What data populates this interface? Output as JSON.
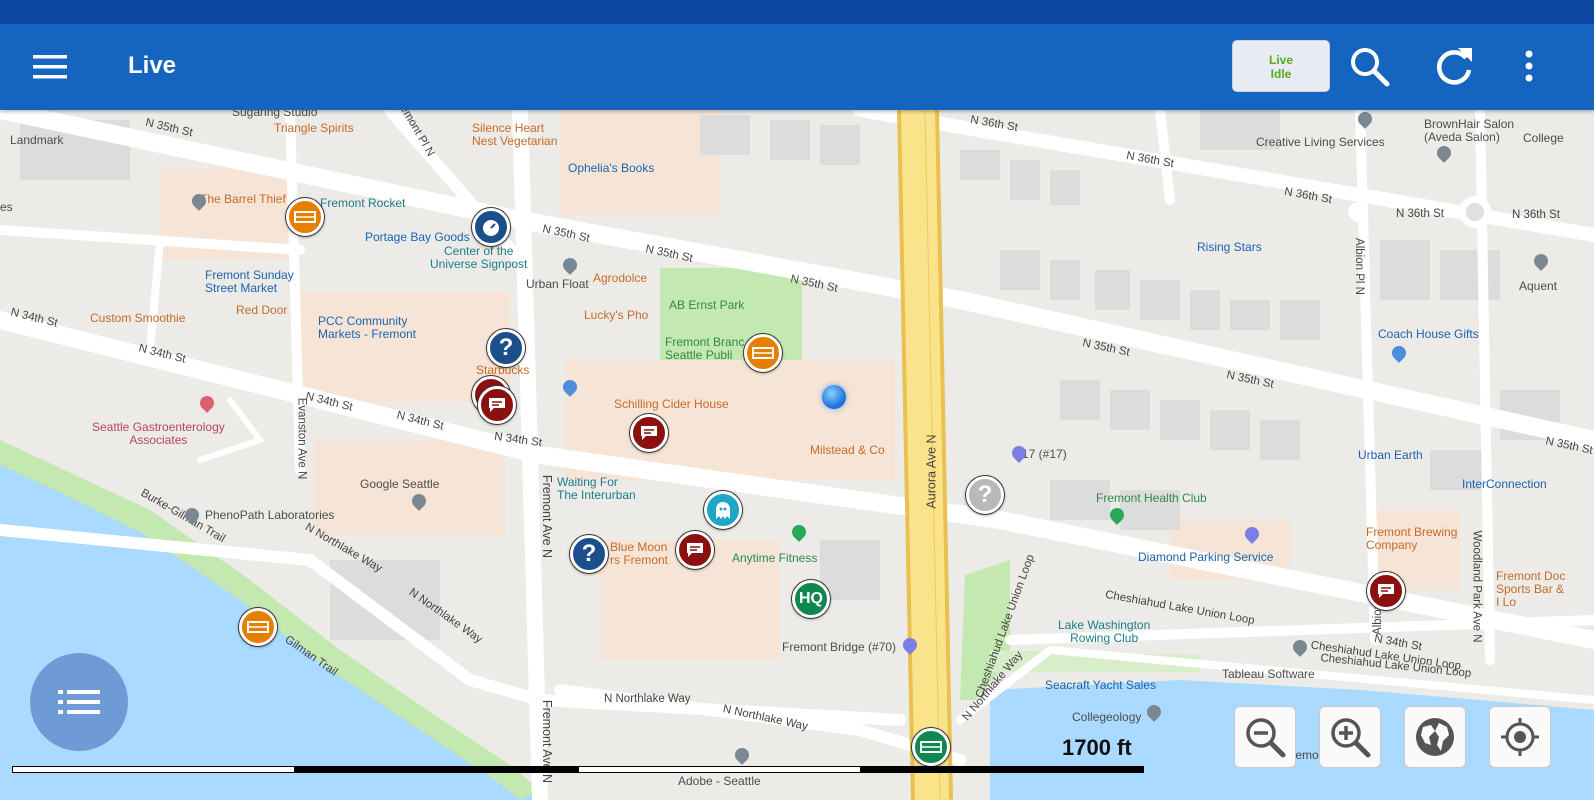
{
  "app": {
    "title": "Live",
    "status_button": {
      "line1": "Live",
      "line2": "Idle"
    },
    "icons": [
      "menu-icon",
      "search-icon",
      "refresh-icon",
      "more-vert-icon"
    ]
  },
  "map": {
    "streets": {
      "n35_a": "N 35th St",
      "n35_b": "N 35th St",
      "n35_c": "N 35th St",
      "n35_d": "N 35th St",
      "n35_e": "N 35th St",
      "n35_f": "N 35th St",
      "n35_g": "N 35th St",
      "n34_a": "N 34th St",
      "n34_b": "N 34th St",
      "n34_c": "N 34th St",
      "n34_d": "N 34th St",
      "n34_e": "N 34th St",
      "n34_f": "N 34th St",
      "n36_a": "N 36th St",
      "n36_b": "N 36th St",
      "n36_c": "N 36th St",
      "n36_d": "N 36th St",
      "n36_e": "N 36th St",
      "aurora": "Aurora Ave N",
      "fremont_a": "Fremont Ave N",
      "fremont_b": "Fremont Ave N",
      "fremont_pl": "Fremont Pl N",
      "evanston": "Evanston Ave N",
      "albion_a": "Albion Pl N",
      "albion_b": "Albion Pl N",
      "woodland": "Woodland Park Ave N",
      "northlake_a": "N Northlake Way",
      "northlake_b": "N Northlake Way",
      "northlake_c": "N Northlake Way",
      "northlake_d": "N Northlake Way",
      "northlake_e": "N Northlake Way",
      "burke": "Burke-Gilman Trail",
      "burke2": "Gilman Trail",
      "cheshiahud_a": "Cheshiahud Lake Union Loop",
      "cheshiahud_b": "Cheshiahud Lake Union Loop",
      "cheshiahud_c": "Cheshiahud Lake Union Loop",
      "cheshiahud_d": "Cheshiahud Lake Union Loop"
    },
    "places": {
      "sugaring": "Sugaring Studio",
      "landmark": "Landmark",
      "triangle": "Triangle Spirits",
      "silence": "Silence Heart\nNest Vegetarian",
      "ophelia": "Ophelia's Books",
      "barrel": "The Barrel Thief",
      "fremont_rocket": "Fremont Rocket",
      "portage": "Portage Bay Goods",
      "center": "Center of the\nUniverse Signpost",
      "sunday": "Fremont Sunday\nStreet Market",
      "red_door": "Red Door",
      "smoothie": "Custom Smoothie",
      "pcc": "PCC Community\nMarkets - Fremont",
      "agrodolce": "Agrodolce",
      "urban_float": "Urban Float",
      "lucky": "Lucky's Pho",
      "ab_ernst": "AB Ernst Park",
      "fremont_branch": "Fremont Branc\nSeattle Publi",
      "starbucks": "Starbucks",
      "gastro": "Seattle Gastroenterology\nAssociates",
      "schilling": "Schilling Cider House",
      "milstead": "Milstead & Co",
      "google": "Google Seattle",
      "waiting": "Waiting For\nThe Interurban",
      "phenopath": "PhenoPath Laboratories",
      "blue_moon": "Blue Moon\nrs Fremont",
      "anytime": "Anytime Fitness",
      "fremont_bridge": "Fremont Bridge (#70)",
      "bus17": "17 (#17)",
      "health_club": "Fremont Health Club",
      "diamond": "Diamond Parking Service",
      "lake_washington": "Lake Washington\nRowing Club",
      "tableau": "Tableau Software",
      "seacraft": "Seacraft Yacht Sales",
      "collegeology": "Collegeology",
      "adobe": "Adobe - Seattle",
      "creative": "Creative Living Services",
      "brownhair": "BrownHair Salon\n(Aveda Salon)",
      "college": "College",
      "rising": "Rising Stars",
      "aquent": "Aquent",
      "coach": "Coach House Gifts",
      "urban_earth": "Urban Earth",
      "interconnection": "InterConnection",
      "brewing": "Fremont Brewing\nCompany",
      "fremont_doc": "Fremont Doc\nSports Bar &\nI Lo",
      "tugboat": "Fremont Tugboat",
      "es": "es"
    },
    "markers": {
      "hq": "HQ",
      "question": "?"
    }
  },
  "controls": {
    "scale_label": "1700 ft",
    "icons": [
      "list-icon",
      "zoom-out-icon",
      "zoom-in-icon",
      "globe-icon",
      "my-location-icon"
    ]
  }
}
